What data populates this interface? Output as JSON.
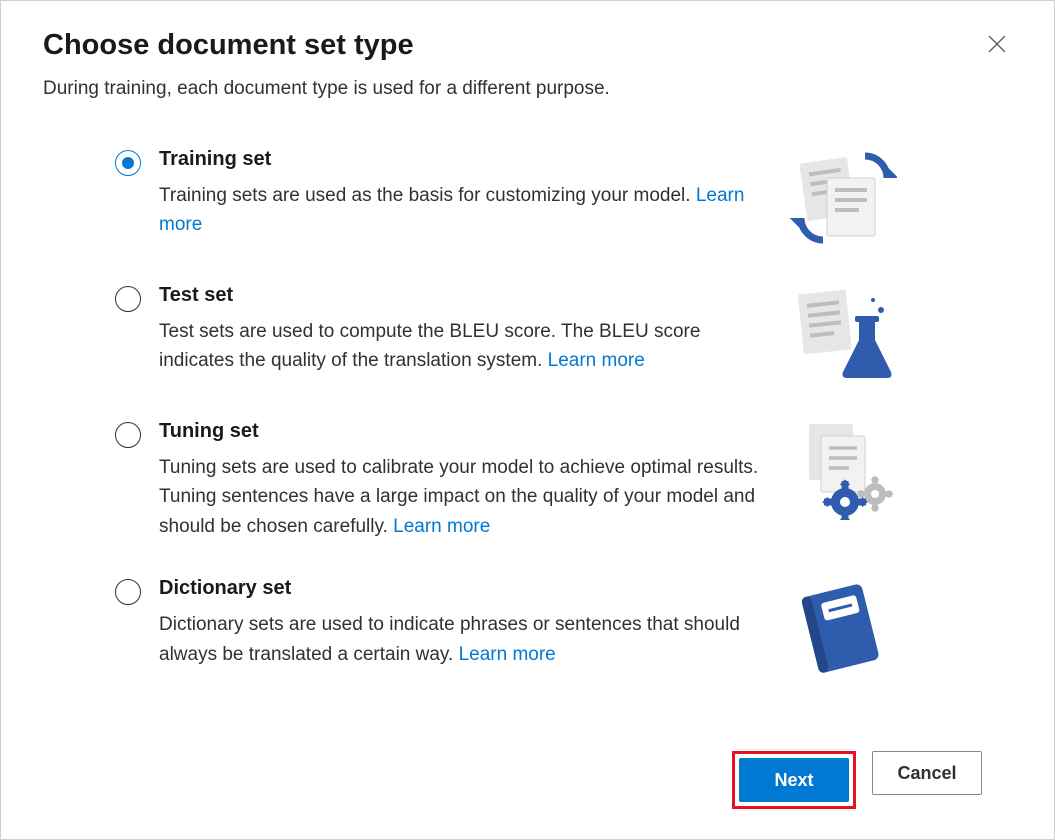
{
  "dialog": {
    "title": "Choose document set type",
    "subtitle": "During training, each document type is used for a different purpose."
  },
  "options": [
    {
      "key": "training",
      "selected": true,
      "title": "Training set",
      "description": "Training sets are used as the basis for customizing your model. ",
      "link": "Learn more"
    },
    {
      "key": "test",
      "selected": false,
      "title": "Test set",
      "description": "Test sets are used to compute the BLEU score. The BLEU score indicates the quality of the translation system. ",
      "link": "Learn more"
    },
    {
      "key": "tuning",
      "selected": false,
      "title": "Tuning set",
      "description": "Tuning sets are used to calibrate your model to achieve optimal results. Tuning sentences have a large impact on the quality of your model and should be chosen carefully. ",
      "link": "Learn more"
    },
    {
      "key": "dictionary",
      "selected": false,
      "title": "Dictionary set",
      "description": "Dictionary sets are used to indicate phrases or sentences that should always be translated a certain way. ",
      "link": "Learn more"
    }
  ],
  "footer": {
    "next": "Next",
    "cancel": "Cancel"
  }
}
